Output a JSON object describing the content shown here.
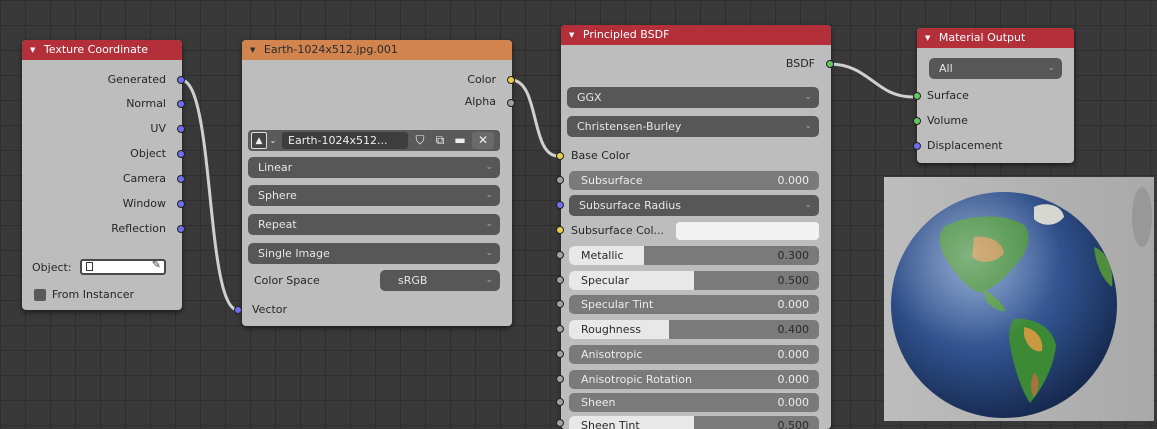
{
  "colors": {
    "header_red": "#b3303a",
    "header_orange": "#d1844e",
    "node_body": "#bdbdbd",
    "socket_vector": "#6f6ff0",
    "socket_color": "#e6d04a",
    "socket_float": "#a1a1a1",
    "socket_shader": "#63c763",
    "wire": "#d0d0d0"
  },
  "texture_coordinate": {
    "title": "Texture Coordinate",
    "outputs": [
      "Generated",
      "Normal",
      "UV",
      "Object",
      "Camera",
      "Window",
      "Reflection"
    ],
    "object_label": "Object:",
    "from_instancer": "From Instancer"
  },
  "image_texture": {
    "title": "Earth-1024x512.jpg.001",
    "output_color": "Color",
    "output_alpha": "Alpha",
    "image_name": "Earth-1024x512...",
    "interpolation": "Linear",
    "projection": "Sphere",
    "extension": "Repeat",
    "source": "Single Image",
    "color_space_label": "Color Space",
    "color_space_value": "sRGB",
    "input_vector": "Vector"
  },
  "principled_bsdf": {
    "title": "Principled BSDF",
    "output": "BSDF",
    "distribution": "GGX",
    "subsurface_method": "Christensen-Burley",
    "base_color": "Base Color",
    "subsurface": {
      "label": "Subsurface",
      "value": "0.000"
    },
    "subsurface_radius": "Subsurface Radius",
    "subsurface_color": "Subsurface Col...",
    "metallic": {
      "label": "Metallic",
      "value": "0.300",
      "fraction": 0.3
    },
    "specular": {
      "label": "Specular",
      "value": "0.500",
      "fraction": 0.5
    },
    "specular_tint": {
      "label": "Specular Tint",
      "value": "0.000"
    },
    "roughness": {
      "label": "Roughness",
      "value": "0.400",
      "fraction": 0.4
    },
    "anisotropic": {
      "label": "Anisotropic",
      "value": "0.000"
    },
    "anisotropic_rotation": {
      "label": "Anisotropic Rotation",
      "value": "0.000"
    },
    "sheen": {
      "label": "Sheen",
      "value": "0.000"
    },
    "sheen_tint": {
      "label": "Sheen Tint",
      "value": "0.500"
    }
  },
  "material_output": {
    "title": "Material Output",
    "target": "All",
    "inputs": [
      "Surface",
      "Volume",
      "Displacement"
    ]
  },
  "preview": {
    "icon": "earth-globe-render"
  }
}
